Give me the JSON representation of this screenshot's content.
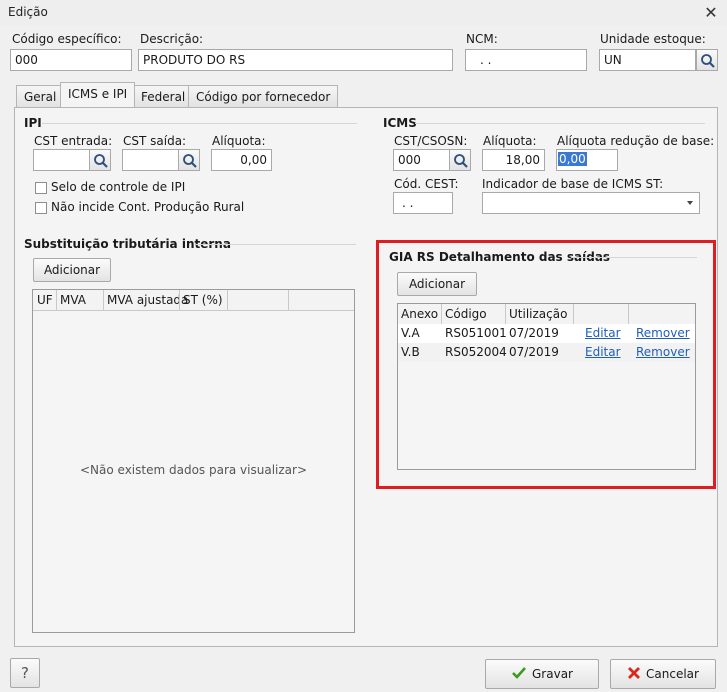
{
  "window": {
    "title": "Edição",
    "close_glyph": "✕"
  },
  "fields": {
    "codigo": {
      "label": "Código específico:",
      "value": "000"
    },
    "descricao": {
      "label": "Descrição:",
      "value": "PRODUTO DO RS"
    },
    "ncm": {
      "label": "NCM:",
      "value": ". ."
    },
    "unidade": {
      "label": "Unidade estoque:",
      "value": "UN"
    }
  },
  "tabs": [
    {
      "label": "Geral"
    },
    {
      "label": "ICMS e IPI",
      "active": true
    },
    {
      "label": "Federal"
    },
    {
      "label": "Código por fornecedor"
    }
  ],
  "ipi": {
    "title": "IPI",
    "cst_entrada": {
      "label": "CST entrada:",
      "value": ""
    },
    "cst_saida": {
      "label": "CST saída:",
      "value": ""
    },
    "aliquota": {
      "label": "Alíquota:",
      "value": "0,00"
    },
    "selo": {
      "label": "Selo de controle de IPI",
      "checked": false
    },
    "nao_incide": {
      "label": "Não incide Cont. Produção Rural",
      "checked": false
    }
  },
  "icms": {
    "title": "ICMS",
    "cst_csosn": {
      "label": "CST/CSOSN:",
      "value": "000"
    },
    "aliquota": {
      "label": "Alíquota:",
      "value": "18,00"
    },
    "reducao": {
      "label": "Alíquota redução de base:",
      "value": "0,00"
    },
    "cest": {
      "label": "Cód. CEST:",
      "value": ". ."
    },
    "indicador": {
      "label": "Indicador de base de ICMS ST:",
      "value": ""
    }
  },
  "st_interna": {
    "title": "Substituição tributária interna",
    "add_button": "Adicionar",
    "columns": [
      "UF",
      "MVA",
      "MVA ajustada",
      "ST (%)",
      "",
      ""
    ],
    "empty_message": "<Não existem dados para visualizar>"
  },
  "gia": {
    "title": "GIA RS Detalhamento das saídas",
    "add_button": "Adicionar",
    "columns": [
      "Anexo",
      "Código",
      "Utilização",
      "",
      ""
    ],
    "rows": [
      {
        "anexo": "V.A",
        "codigo": "RS051001",
        "utilizacao": "07/2019",
        "edit": "Editar",
        "remove": "Remover"
      },
      {
        "anexo": "V.B",
        "codigo": "RS052004",
        "utilizacao": "07/2019",
        "edit": "Editar",
        "remove": "Remover"
      }
    ]
  },
  "footer": {
    "help": "?",
    "save": "Gravar",
    "cancel": "Cancelar"
  },
  "colors": {
    "highlight": "#e11b22",
    "link": "#1f5fb7",
    "selection": "#3a78d6"
  }
}
